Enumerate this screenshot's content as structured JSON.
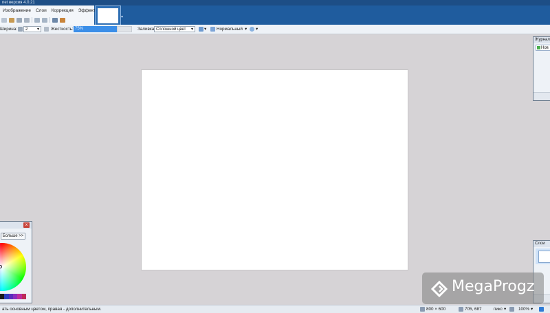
{
  "window": {
    "title": "net версия 4.0.21"
  },
  "menu": {
    "items": [
      "Изображение",
      "Слои",
      "Коррекция",
      "Эффекты"
    ]
  },
  "toolbar": {
    "width_label": "Ширина:",
    "width_value": "2",
    "hardness_label": "Жесткость:",
    "hardness_value": "75%",
    "fill_label": "Заливка:",
    "fill_value": "Сплошной цвет",
    "blend_value": "Нормальный"
  },
  "panels": {
    "history": {
      "title": "Журнал",
      "item": "Нов"
    },
    "layers": {
      "title": "Слои"
    },
    "palette": {
      "more_label": "Больше >>",
      "close_glyph": "x"
    }
  },
  "statusbar": {
    "hint": "ать основным цветом, правая - дополнительным.",
    "image_size": "800 × 600",
    "cursor_pos": "705, 687",
    "units": "пикс",
    "zoom": "100%"
  },
  "watermark": {
    "text": "MegaProgz"
  }
}
